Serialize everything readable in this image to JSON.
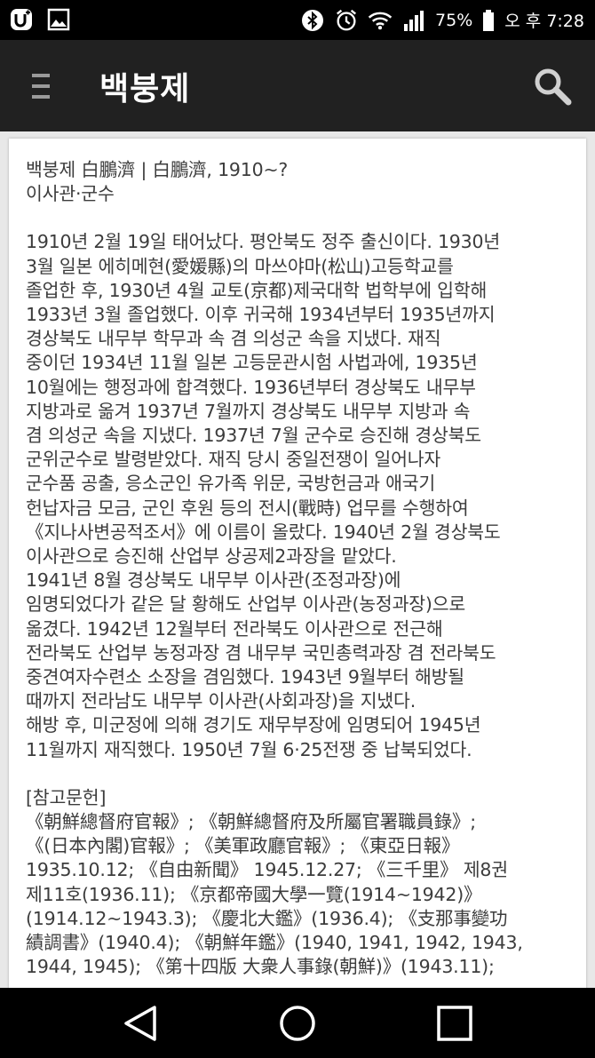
{
  "status_bar": {
    "battery_percent": "75%",
    "time": "오 후 7:28",
    "icons": [
      "u-plus-icon",
      "gallery-icon",
      "bluetooth-icon",
      "alarm-icon",
      "wifi-icon",
      "signal-icon",
      "battery-icon"
    ]
  },
  "app_bar": {
    "title": "백붕제",
    "menu_icon": "menu-icon",
    "search_icon": "search-icon"
  },
  "article": {
    "heading": "백붕제 白鵬濟 | 白鵬濟, 1910~?",
    "subheading": "이사관·군수",
    "body": "1910년 2월 19일 태어났다. 평안북도 정주 출신이다. 1930년\n3월 일본 에히메현(愛媛縣)의 마쓰야마(松山)고등학교를\n졸업한 후, 1930년 4월 교토(京都)제국대학 법학부에 입학해\n1933년 3월 졸업했다. 이후 귀국해 1934년부터 1935년까지\n경상북도 내무부 학무과 속 겸 의성군 속을 지냈다. 재직\n중이던 1934년 11월 일본 고등문관시험 사법과에, 1935년\n10월에는 행정과에 합격했다. 1936년부터 경상북도 내무부\n지방과로 옮겨 1937년 7월까지 경상북도 내무부 지방과 속\n겸 의성군 속을 지냈다. 1937년 7월 군수로 승진해 경상북도\n군위군수로 발령받았다. 재직 당시 중일전쟁이 일어나자\n군수품 공출, 응소군인 유가족 위문, 국방헌금과 애국기\n헌납자금 모금, 군인 후원 등의 전시(戰時) 업무를 수행하여\n《지나사변공적조서》에 이름이 올랐다. 1940년 2월 경상북도\n이사관으로 승진해 산업부 상공제2과장을 맡았다.\n1941년 8월 경상북도 내무부 이사관(조정과장)에\n임명되었다가 같은 달 황해도 산업부 이사관(농정과장)으로\n옮겼다. 1942년 12월부터 전라북도 이사관으로 전근해\n전라북도 산업부 농정과장 겸 내무부 국민총력과장 겸 전라북도\n중견여자수련소 소장을 겸임했다. 1943년 9월부터 해방될\n때까지 전라남도 내무부 이사관(사회과장)을 지냈다.\n해방 후, 미군정에 의해 경기도 재무부장에 임명되어 1945년\n11월까지 재직했다. 1950년 7월 6·25전쟁 중 납북되었다.",
    "references_title": "[참고문헌]",
    "references": "《朝鮮總督府官報》; 《朝鮮總督府及所屬官署職員錄》;\n《(日本內閣)官報》; 《美軍政廳官報》; 《東亞日報》\n1935.10.12; 《自由新聞》 1945.12.27; 《三千里》 제8권\n제11호(1936.11); 《京都帝國大學一覽(1914~1942)》\n(1914.12~1943.3); 《慶北大鑑》(1936.4); 《支那事變功\n績調書》(1940.4); 《朝鮮年鑑》(1940, 1941, 1942, 1943,\n1944, 1945); 《第十四版 大衆人事錄(朝鮮)》(1943.11);"
  },
  "nav_bar": {
    "back": "back-icon",
    "home": "home-icon",
    "recents": "recents-icon"
  }
}
